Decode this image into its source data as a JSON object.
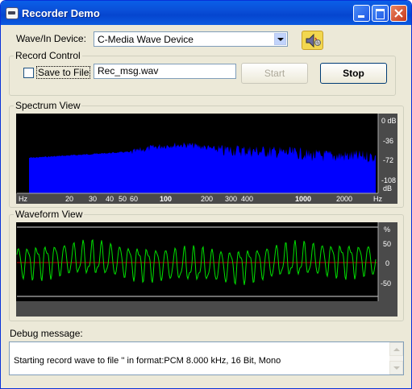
{
  "window": {
    "title": "Recorder Demo"
  },
  "device": {
    "label": "Wave/In Device:",
    "selected": "C-Media Wave Device"
  },
  "record_control": {
    "group_label": "Record Control",
    "save_checkbox_label": "Save to File",
    "save_checked": false,
    "file_name": "Rec_msg.wav",
    "start_label": "Start",
    "stop_label": "Stop"
  },
  "spectrum": {
    "group_label": "Spectrum View",
    "y_ticks": [
      "0 dB",
      "-36",
      "-72",
      "-108",
      "dB"
    ],
    "x_ticks": [
      "Hz",
      "20",
      "30",
      "40",
      "50",
      "60",
      "100",
      "200",
      "300",
      "400",
      "1000",
      "2000",
      "Hz"
    ],
    "fill_color": "#0000ff"
  },
  "waveform": {
    "group_label": "Waveform View",
    "y_ticks": [
      "%",
      "50",
      "0",
      "-50"
    ],
    "trace_color": "#00e000",
    "zero_line_color": "#c00000"
  },
  "debug": {
    "label": "Debug message:",
    "text": "Starting record wave to file '' in format:PCM 8.000 kHz, 16 Bit, Mono"
  },
  "icons": [
    "recorder-app-icon",
    "speaker-icon",
    "minimize-icon",
    "maximize-icon",
    "close-icon",
    "chevron-down-icon"
  ]
}
